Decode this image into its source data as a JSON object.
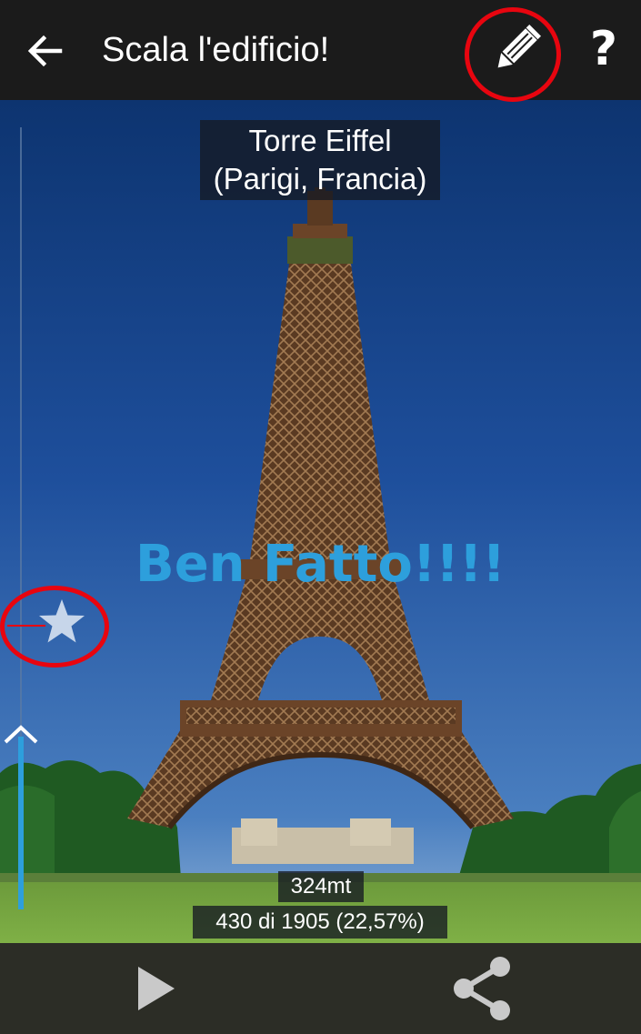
{
  "header": {
    "title": "Scala l'edificio!",
    "back_icon": "arrow-left-icon",
    "edit_icon": "pencil-icon",
    "help_label": "?"
  },
  "landmark": {
    "name": "Torre Eiffel",
    "location": "(Parigi, Francia)"
  },
  "status": {
    "message": "Ben Fatto!!!!",
    "height": "324mt",
    "progress": "430 di 1905 (22,57%)",
    "progress_fraction": 0.2257
  },
  "footer": {
    "play_icon": "play-icon",
    "share_icon": "share-icon"
  },
  "colors": {
    "accent": "#2d9fdc",
    "highlight_ring": "#e8050f",
    "topbar": "#1b1b1b",
    "bottombar": "#2c2d26"
  }
}
